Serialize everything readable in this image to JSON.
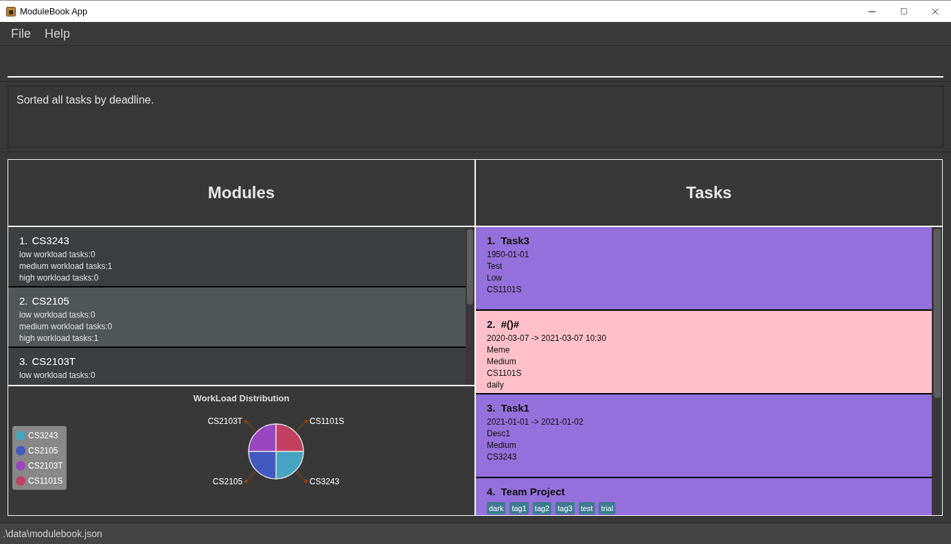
{
  "window": {
    "title": "ModuleBook App"
  },
  "menu": [
    "File",
    "Help"
  ],
  "result": "Sorted all tasks by deadline.",
  "modules_panel": {
    "title": "Modules",
    "items": [
      {
        "index": "1.",
        "code": "CS3243",
        "lines": [
          "low workload tasks:0",
          "medium workload tasks:1",
          "high workload tasks:0"
        ],
        "selected": false
      },
      {
        "index": "2.",
        "code": "CS2105",
        "lines": [
          "low workload tasks:0",
          "medium workload tasks:0",
          "high workload tasks:1"
        ],
        "selected": true
      },
      {
        "index": "3.",
        "code": "CS2103T",
        "lines": [
          "low workload tasks:0"
        ],
        "selected": false
      }
    ],
    "chart": {
      "chart_data": {
        "type": "pie",
        "title": "WorkLoad Distribution",
        "categories": [
          "CS3243",
          "CS2105",
          "CS2103T",
          "CS1101S"
        ],
        "values": [
          25,
          25,
          25,
          25
        ],
        "legend": true,
        "colors": [
          "#45a5c0",
          "#4358c0",
          "#9a46c0",
          "#c44060"
        ]
      }
    }
  },
  "tasks_panel": {
    "title": "Tasks",
    "items": [
      {
        "index": "1.",
        "name": "Task3",
        "lines": [
          "1950-01-01",
          "Test",
          "Low",
          "CS1101S"
        ],
        "color": "#9370db"
      },
      {
        "index": "2.",
        "name": "#()#",
        "lines": [
          "2020-03-07 -> 2021-03-07 10:30",
          "Meme",
          "Medium",
          "CS1101S",
          "daily"
        ],
        "color": "#ffc0cb"
      },
      {
        "index": "3.",
        "name": "Task1",
        "lines": [
          "2021-01-01 -> 2021-01-02",
          "Desc1",
          "Medium",
          "CS3243"
        ],
        "color": "#9370db"
      },
      {
        "index": "4.",
        "name": "Team Project",
        "tags": [
          "dark",
          "tag1",
          "tag2",
          "tag3",
          "test",
          "trial"
        ],
        "color": "#9370db"
      }
    ]
  },
  "status_bar": ".\\data\\modulebook.json"
}
